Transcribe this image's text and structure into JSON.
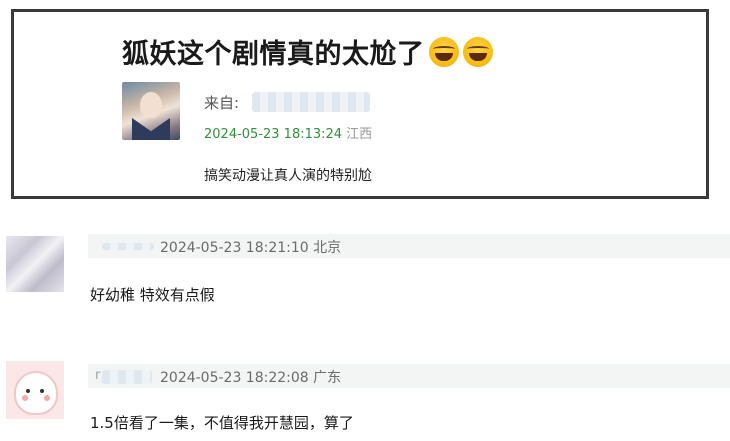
{
  "post": {
    "title": "狐妖这个剧情真的太尬了",
    "title_emojis": [
      "laughing-crying-emoji",
      "laughing-crying-emoji"
    ],
    "source_label": "来自:",
    "timestamp": "2024-05-23 18:13:24",
    "region": "江西",
    "body": "搞笑动漫让真人演的特别尬"
  },
  "comments": [
    {
      "timestamp": "2024-05-23 18:21:10",
      "region": "北京",
      "text": "好幼稚 特效有点假"
    },
    {
      "name_fragment": "r",
      "timestamp": "2024-05-23 18:22:08",
      "region": "广东",
      "text": "1.5倍看了一集，不值得我开慧园，算了"
    }
  ],
  "colors": {
    "timestamp_green": "#2f8f3a",
    "card_border": "#3a3a3a",
    "comment_header_bg": "#f2f5f3"
  }
}
